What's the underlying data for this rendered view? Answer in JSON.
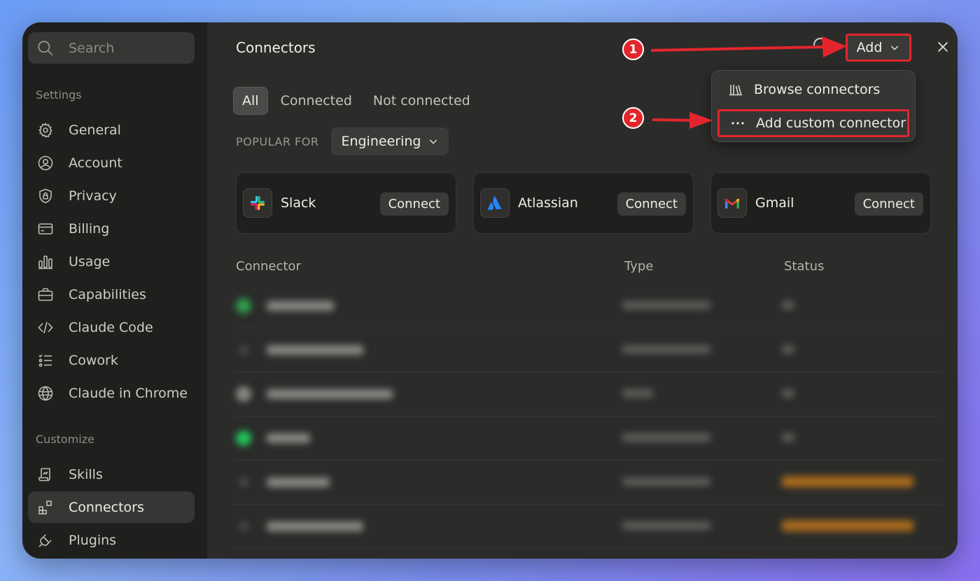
{
  "sidebar": {
    "search_placeholder": "Search",
    "settings_label": "Settings",
    "settings_items": [
      {
        "label": "General",
        "icon": "gear-icon"
      },
      {
        "label": "Account",
        "icon": "user-circle-icon"
      },
      {
        "label": "Privacy",
        "icon": "shield-lock-icon"
      },
      {
        "label": "Billing",
        "icon": "credit-card-icon"
      },
      {
        "label": "Usage",
        "icon": "bar-chart-icon"
      },
      {
        "label": "Capabilities",
        "icon": "briefcase-icon"
      },
      {
        "label": "Claude Code",
        "icon": "code-icon"
      },
      {
        "label": "Cowork",
        "icon": "checklist-icon"
      },
      {
        "label": "Claude in Chrome",
        "icon": "globe-icon"
      }
    ],
    "customize_label": "Customize",
    "customize_items": [
      {
        "label": "Skills",
        "icon": "scroll-icon"
      },
      {
        "label": "Connectors",
        "icon": "connectors-icon",
        "active": true
      },
      {
        "label": "Plugins",
        "icon": "plug-icon"
      }
    ]
  },
  "header": {
    "title": "Connectors",
    "add_label": "Add"
  },
  "tabs": [
    "All",
    "Connected",
    "Not connected"
  ],
  "popular": {
    "label": "POPULAR FOR",
    "selected": "Engineering"
  },
  "featured": [
    {
      "name": "Slack",
      "button": "Connect"
    },
    {
      "name": "Atlassian",
      "button": "Connect"
    },
    {
      "name": "Gmail",
      "button": "Connect"
    }
  ],
  "table": {
    "headers": [
      "Connector",
      "Type",
      "Status"
    ]
  },
  "dropdown": {
    "items": [
      {
        "label": "Browse connectors",
        "icon": "library-icon"
      },
      {
        "label": "Add custom connector",
        "icon": "more-dots-icon"
      }
    ]
  },
  "annotations": [
    "1",
    "2"
  ],
  "colors": {
    "annotation_red": "#e3262d",
    "window_bg": "#2b2b2a",
    "sidebar_bg": "#1f1f1e"
  }
}
